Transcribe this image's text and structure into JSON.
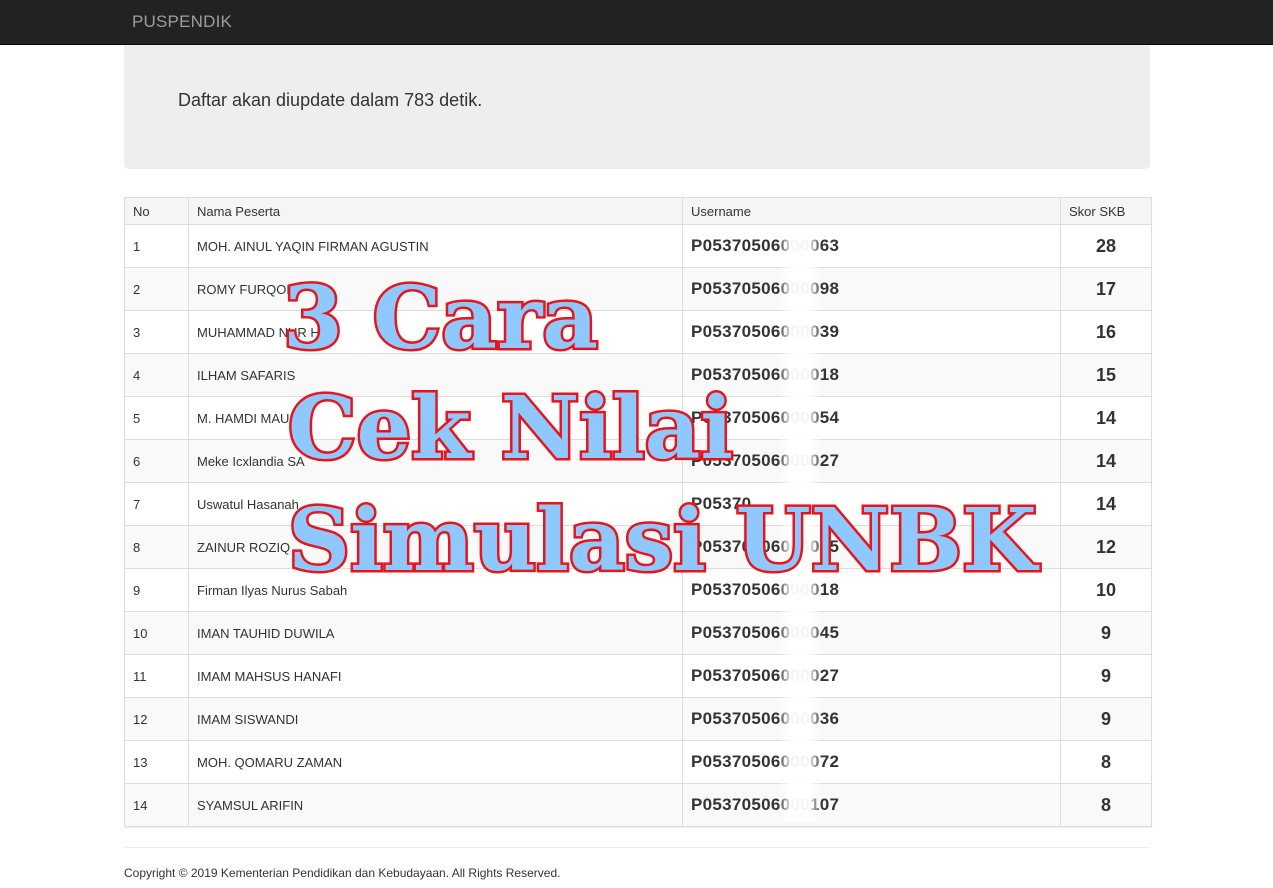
{
  "navbar": {
    "brand": "PUSPENDIK"
  },
  "notice": {
    "text": "Daftar akan diupdate dalam 783 detik."
  },
  "table": {
    "headers": {
      "no": "No",
      "name": "Nama Peserta",
      "username": "Username",
      "score": "Skor SKB"
    },
    "rows": [
      {
        "no": "1",
        "name": "MOH. AINUL YAQIN FIRMAN AGUSTIN",
        "username": "P05370506000063",
        "score": "28"
      },
      {
        "no": "2",
        "name": "ROMY FURQON",
        "username": "P05370506000098",
        "score": "17"
      },
      {
        "no": "3",
        "name": "MUHAMMAD NUR H",
        "username": "P05370506000039",
        "score": "16"
      },
      {
        "no": "4",
        "name": "ILHAM SAFARIS",
        "username": "P05370506000018",
        "score": "15"
      },
      {
        "no": "5",
        "name": "M. HAMDI MAU",
        "username": "P05370506000054",
        "score": "14"
      },
      {
        "no": "6",
        "name": "Meke Icxlandia SA",
        "username": "P05370506000027",
        "score": "14"
      },
      {
        "no": "7",
        "name": "Uswatul Hasanah",
        "username": "P05370",
        "score": "14"
      },
      {
        "no": "8",
        "name": "ZAINUR ROZIQ",
        "username": "P05370506000035",
        "score": "12"
      },
      {
        "no": "9",
        "name": "Firman Ilyas Nurus Sabah",
        "username": "P05370506000018",
        "score": "10"
      },
      {
        "no": "10",
        "name": "IMAN TAUHID DUWILA",
        "username": "P05370506000045",
        "score": "9"
      },
      {
        "no": "11",
        "name": "IMAM MAHSUS HANAFI",
        "username": "P05370506000027",
        "score": "9"
      },
      {
        "no": "12",
        "name": "IMAM SISWANDI",
        "username": "P05370506000036",
        "score": "9"
      },
      {
        "no": "13",
        "name": "MOH. QOMARU ZAMAN",
        "username": "P05370506000072",
        "score": "8"
      },
      {
        "no": "14",
        "name": "SYAMSUL ARIFIN",
        "username": "P05370506000107",
        "score": "8"
      }
    ]
  },
  "overlay": {
    "line1": "3 Cara",
    "line2": "Cek Nilai",
    "line3": "Simulasi UNBK",
    "fill_color": "#8ec8ff",
    "stroke_color": "#e8141c"
  },
  "footer": {
    "text": "Copyright © 2019 Kementerian Pendidikan dan Kebudayaan. All Rights Reserved."
  }
}
